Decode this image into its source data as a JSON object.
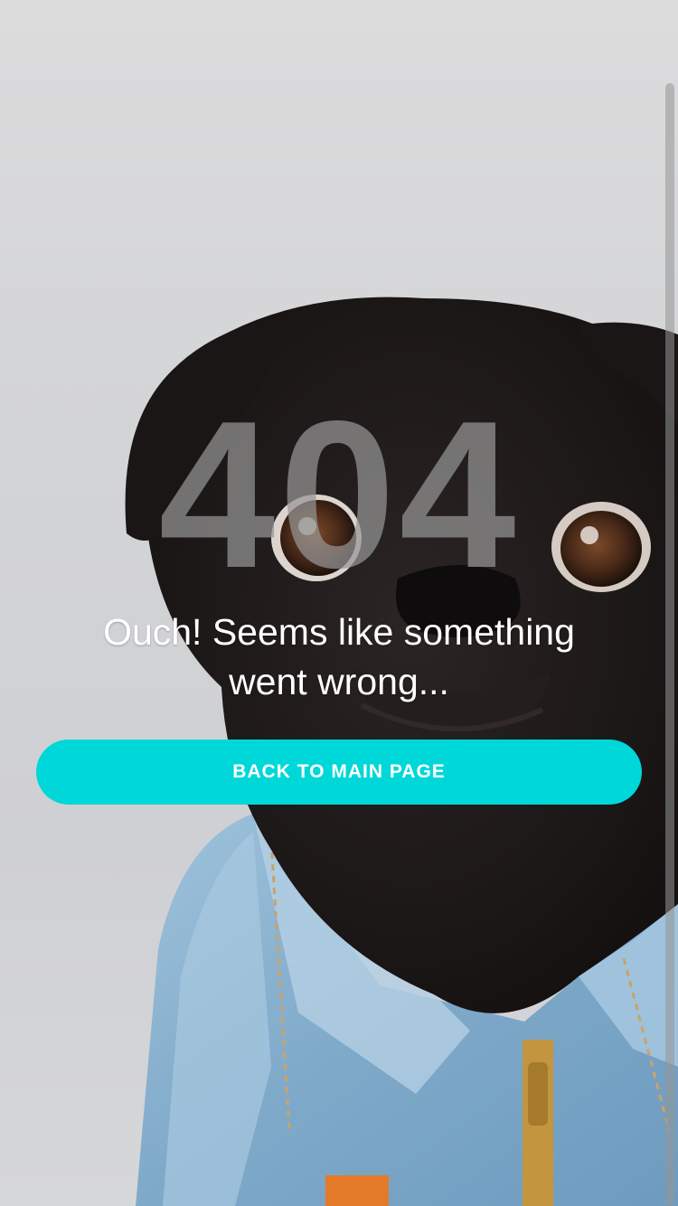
{
  "error_page": {
    "code": "404",
    "message": "Ouch! Seems like something went wrong...",
    "button_label": "BACK TO MAIN PAGE"
  },
  "background": {
    "image": "pug-in-denim-jacket-photo"
  },
  "colors": {
    "accent": "#00d7d9",
    "code_text": "#969696",
    "message_text": "#ffffff",
    "backdrop": "#d3d4d6"
  }
}
